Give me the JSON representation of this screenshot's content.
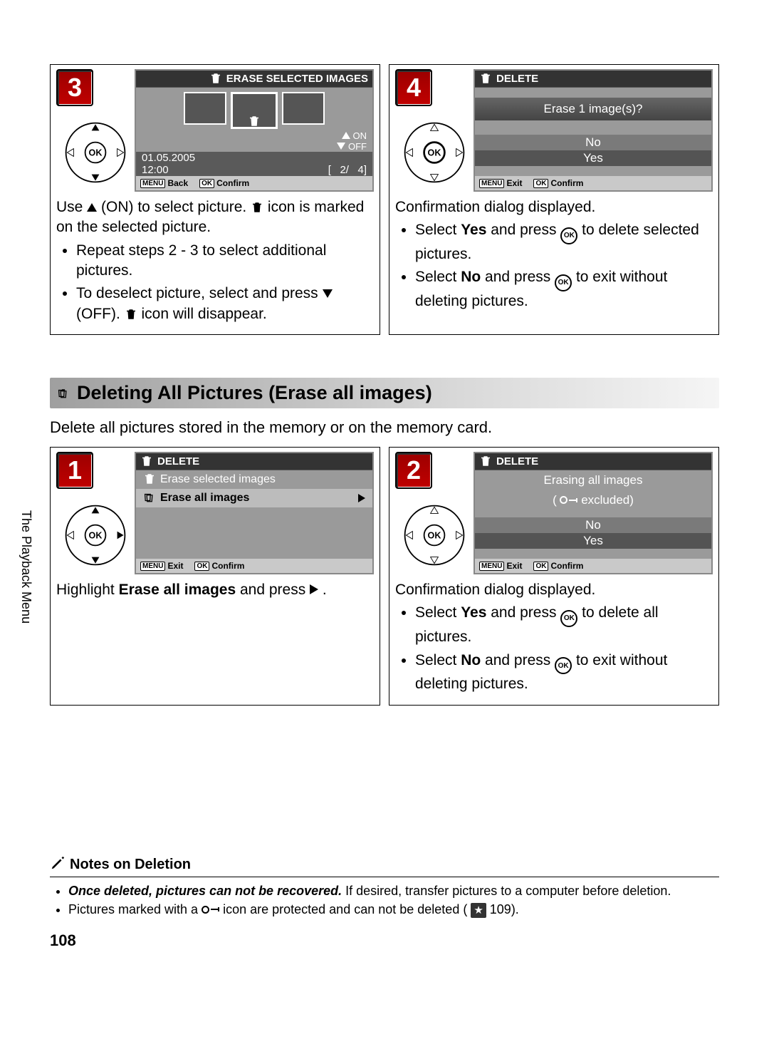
{
  "step3": {
    "lcd_title": "ERASE SELECTED IMAGES",
    "on": "ON",
    "off": "OFF",
    "date": "01.05.2005",
    "time": "12:00",
    "counter_l": "2/",
    "counter_r": "4]",
    "foot_back": "Back",
    "foot_confirm": "Confirm",
    "text_a": "Use ",
    "text_b": " (ON) to select picture. ",
    "text_c": " icon is marked on the selected picture.",
    "bullet1": "Repeat steps 2 - 3 to select additional pictures.",
    "bullet2a": "To deselect picture, select and press ",
    "bullet2b": " (OFF). ",
    "bullet2c": " icon will disappear."
  },
  "step4": {
    "lcd_title": "DELETE",
    "question": "Erase 1 image(s)?",
    "no": "No",
    "yes": "Yes",
    "foot_exit": "Exit",
    "foot_confirm": "Confirm",
    "text_a": "Confirmation dialog displayed.",
    "bullet1a": "Select ",
    "bullet1b": "Yes",
    "bullet1c": " and press ",
    "bullet1d": " to delete selected pictures.",
    "bullet2a": "Select ",
    "bullet2b": "No",
    "bullet2c": " and press ",
    "bullet2d": " to exit without deleting pictures."
  },
  "section_title": "Deleting All Pictures (Erase all images)",
  "section_intro": "Delete all pictures stored in the memory or on the memory card.",
  "step1b": {
    "lcd_title": "DELETE",
    "row1": "Erase selected images",
    "row2": "Erase all images",
    "foot_exit": "Exit",
    "foot_confirm": "Confirm",
    "text_a": "Highlight ",
    "text_b": "Erase all images",
    "text_c": " and press "
  },
  "step2b": {
    "lcd_title": "DELETE",
    "line1": "Erasing all images",
    "line2a": "( ",
    "line2b": " excluded)",
    "no": "No",
    "yes": "Yes",
    "foot_exit": "Exit",
    "foot_confirm": "Confirm",
    "text_a": "Confirmation dialog displayed.",
    "bullet1a": "Select ",
    "bullet1b": "Yes",
    "bullet1c": " and press ",
    "bullet1d": " to delete all pictures.",
    "bullet2a": "Select ",
    "bullet2b": "No",
    "bullet2c": " and press ",
    "bullet2d": " to exit without deleting pictures."
  },
  "side_label": "The Playback Menu",
  "notes": {
    "title": "Notes on Deletion",
    "b1_strong": "Once deleted, pictures can not be recovered.",
    "b1_rest": " If desired, transfer pictures to a computer before deletion.",
    "b2a": "Pictures marked with a ",
    "b2b": " icon are protected and can not be deleted ( ",
    "b2c": " 109)."
  },
  "page_number": "108",
  "menu_key": "MENU",
  "ok_key": "OK"
}
